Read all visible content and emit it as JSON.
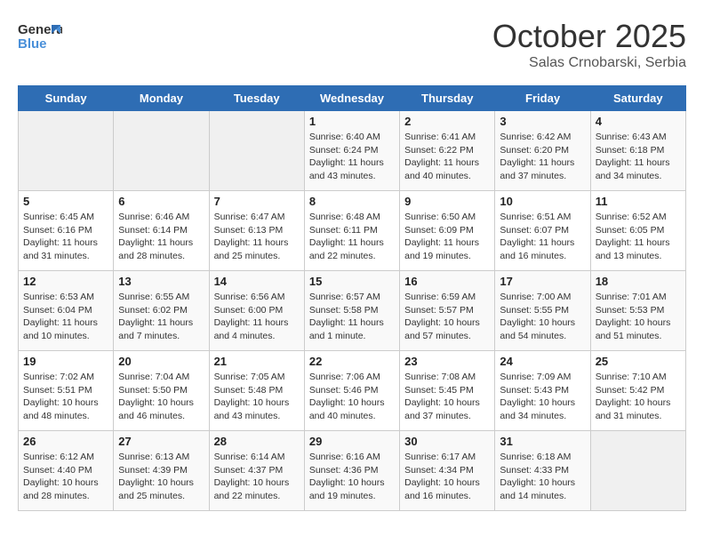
{
  "header": {
    "logo_line1": "General",
    "logo_line2": "Blue",
    "month": "October 2025",
    "location": "Salas Crnobarski, Serbia"
  },
  "weekdays": [
    "Sunday",
    "Monday",
    "Tuesday",
    "Wednesday",
    "Thursday",
    "Friday",
    "Saturday"
  ],
  "weeks": [
    [
      {
        "day": "",
        "info": ""
      },
      {
        "day": "",
        "info": ""
      },
      {
        "day": "",
        "info": ""
      },
      {
        "day": "1",
        "info": "Sunrise: 6:40 AM\nSunset: 6:24 PM\nDaylight: 11 hours\nand 43 minutes."
      },
      {
        "day": "2",
        "info": "Sunrise: 6:41 AM\nSunset: 6:22 PM\nDaylight: 11 hours\nand 40 minutes."
      },
      {
        "day": "3",
        "info": "Sunrise: 6:42 AM\nSunset: 6:20 PM\nDaylight: 11 hours\nand 37 minutes."
      },
      {
        "day": "4",
        "info": "Sunrise: 6:43 AM\nSunset: 6:18 PM\nDaylight: 11 hours\nand 34 minutes."
      }
    ],
    [
      {
        "day": "5",
        "info": "Sunrise: 6:45 AM\nSunset: 6:16 PM\nDaylight: 11 hours\nand 31 minutes."
      },
      {
        "day": "6",
        "info": "Sunrise: 6:46 AM\nSunset: 6:14 PM\nDaylight: 11 hours\nand 28 minutes."
      },
      {
        "day": "7",
        "info": "Sunrise: 6:47 AM\nSunset: 6:13 PM\nDaylight: 11 hours\nand 25 minutes."
      },
      {
        "day": "8",
        "info": "Sunrise: 6:48 AM\nSunset: 6:11 PM\nDaylight: 11 hours\nand 22 minutes."
      },
      {
        "day": "9",
        "info": "Sunrise: 6:50 AM\nSunset: 6:09 PM\nDaylight: 11 hours\nand 19 minutes."
      },
      {
        "day": "10",
        "info": "Sunrise: 6:51 AM\nSunset: 6:07 PM\nDaylight: 11 hours\nand 16 minutes."
      },
      {
        "day": "11",
        "info": "Sunrise: 6:52 AM\nSunset: 6:05 PM\nDaylight: 11 hours\nand 13 minutes."
      }
    ],
    [
      {
        "day": "12",
        "info": "Sunrise: 6:53 AM\nSunset: 6:04 PM\nDaylight: 11 hours\nand 10 minutes."
      },
      {
        "day": "13",
        "info": "Sunrise: 6:55 AM\nSunset: 6:02 PM\nDaylight: 11 hours\nand 7 minutes."
      },
      {
        "day": "14",
        "info": "Sunrise: 6:56 AM\nSunset: 6:00 PM\nDaylight: 11 hours\nand 4 minutes."
      },
      {
        "day": "15",
        "info": "Sunrise: 6:57 AM\nSunset: 5:58 PM\nDaylight: 11 hours\nand 1 minute."
      },
      {
        "day": "16",
        "info": "Sunrise: 6:59 AM\nSunset: 5:57 PM\nDaylight: 10 hours\nand 57 minutes."
      },
      {
        "day": "17",
        "info": "Sunrise: 7:00 AM\nSunset: 5:55 PM\nDaylight: 10 hours\nand 54 minutes."
      },
      {
        "day": "18",
        "info": "Sunrise: 7:01 AM\nSunset: 5:53 PM\nDaylight: 10 hours\nand 51 minutes."
      }
    ],
    [
      {
        "day": "19",
        "info": "Sunrise: 7:02 AM\nSunset: 5:51 PM\nDaylight: 10 hours\nand 48 minutes."
      },
      {
        "day": "20",
        "info": "Sunrise: 7:04 AM\nSunset: 5:50 PM\nDaylight: 10 hours\nand 46 minutes."
      },
      {
        "day": "21",
        "info": "Sunrise: 7:05 AM\nSunset: 5:48 PM\nDaylight: 10 hours\nand 43 minutes."
      },
      {
        "day": "22",
        "info": "Sunrise: 7:06 AM\nSunset: 5:46 PM\nDaylight: 10 hours\nand 40 minutes."
      },
      {
        "day": "23",
        "info": "Sunrise: 7:08 AM\nSunset: 5:45 PM\nDaylight: 10 hours\nand 37 minutes."
      },
      {
        "day": "24",
        "info": "Sunrise: 7:09 AM\nSunset: 5:43 PM\nDaylight: 10 hours\nand 34 minutes."
      },
      {
        "day": "25",
        "info": "Sunrise: 7:10 AM\nSunset: 5:42 PM\nDaylight: 10 hours\nand 31 minutes."
      }
    ],
    [
      {
        "day": "26",
        "info": "Sunrise: 6:12 AM\nSunset: 4:40 PM\nDaylight: 10 hours\nand 28 minutes."
      },
      {
        "day": "27",
        "info": "Sunrise: 6:13 AM\nSunset: 4:39 PM\nDaylight: 10 hours\nand 25 minutes."
      },
      {
        "day": "28",
        "info": "Sunrise: 6:14 AM\nSunset: 4:37 PM\nDaylight: 10 hours\nand 22 minutes."
      },
      {
        "day": "29",
        "info": "Sunrise: 6:16 AM\nSunset: 4:36 PM\nDaylight: 10 hours\nand 19 minutes."
      },
      {
        "day": "30",
        "info": "Sunrise: 6:17 AM\nSunset: 4:34 PM\nDaylight: 10 hours\nand 16 minutes."
      },
      {
        "day": "31",
        "info": "Sunrise: 6:18 AM\nSunset: 4:33 PM\nDaylight: 10 hours\nand 14 minutes."
      },
      {
        "day": "",
        "info": ""
      }
    ]
  ]
}
